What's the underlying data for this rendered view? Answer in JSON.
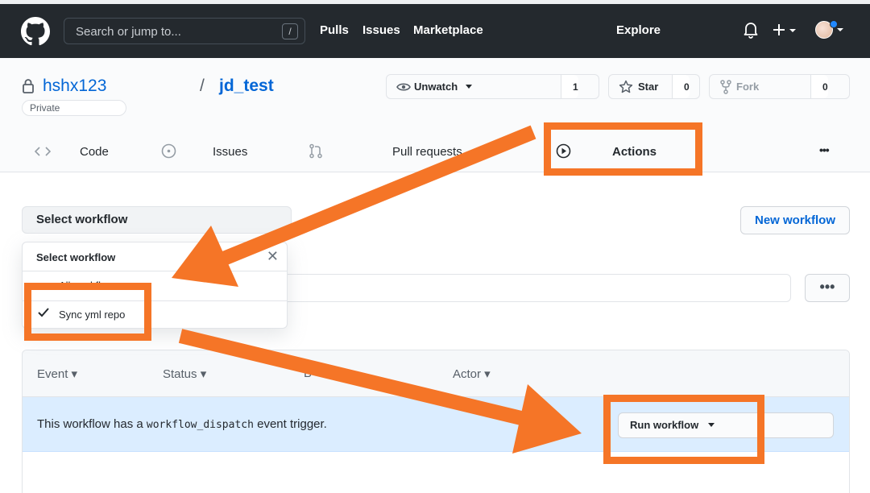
{
  "header": {
    "search_placeholder": "Search or jump to...",
    "search_shortcut": "/",
    "nav": [
      "Pulls",
      "Issues",
      "Marketplace",
      "Explore"
    ]
  },
  "repo": {
    "owner": "hshx123",
    "separator": "/",
    "name": "jd_test",
    "visibility": "Private",
    "watch_label": "Unwatch",
    "watch_count": "1",
    "star_label": "Star",
    "star_count": "0",
    "fork_label": "Fork",
    "fork_count": "0"
  },
  "tabs": {
    "code": "Code",
    "issues": "Issues",
    "pulls": "Pull requests",
    "actions": "Actions",
    "more": "•••"
  },
  "main": {
    "select_workflow": "Select workflow",
    "new_workflow": "New workflow",
    "more": "•••"
  },
  "dropdown": {
    "title": "Select workflow",
    "item_all": "All workflows",
    "item_selected": "Sync yml repo"
  },
  "runs": {
    "col_event": "Event",
    "col_status": "Status",
    "col_branch": "B",
    "col_actor": "Actor",
    "dispatch_prefix": "This workflow has a",
    "dispatch_code": "workflow_dispatch",
    "dispatch_suffix": "event trigger.",
    "run_button": "Run workflow"
  },
  "colors": {
    "annotation": "#f57527",
    "link": "#0366d6",
    "header_bg": "#24292e"
  }
}
